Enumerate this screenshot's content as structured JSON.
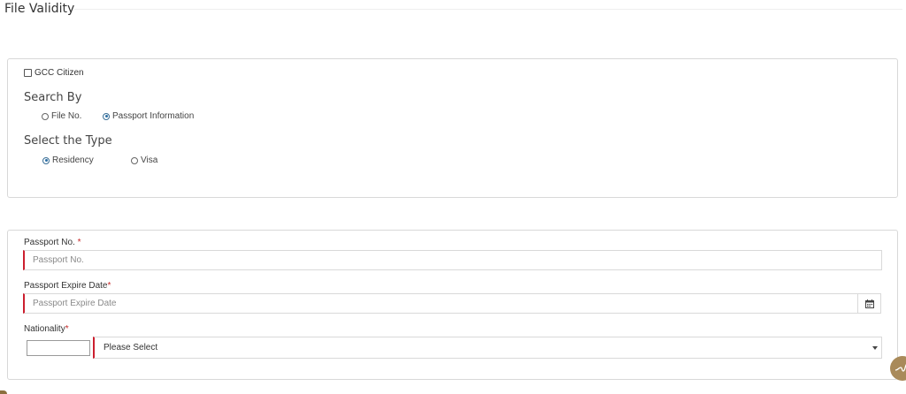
{
  "page": {
    "title": "File Validity"
  },
  "search_panel": {
    "gcc_citizen": {
      "label": "GCC Citizen",
      "checked": false
    },
    "search_by": {
      "label": "Search By",
      "options": [
        {
          "label": "File No.",
          "selected": false
        },
        {
          "label": "Passport Information",
          "selected": true
        }
      ]
    },
    "select_type": {
      "label": "Select the Type",
      "options": [
        {
          "label": "Residency",
          "selected": true
        },
        {
          "label": "Visa",
          "selected": false
        }
      ]
    }
  },
  "form_panel": {
    "passport_no": {
      "label": "Passport No.",
      "required_mark": "*",
      "placeholder": "Passport No."
    },
    "passport_expire": {
      "label": "Passport Expire Date",
      "required_mark": "*",
      "placeholder": "Passport Expire Date"
    },
    "nationality": {
      "label": "Nationality",
      "required_mark": "*",
      "code_value": "",
      "selected": "Please Select"
    }
  },
  "colors": {
    "required": "#cc1f2f",
    "accent": "#2b6ea3",
    "float_button": "#a98a5a"
  },
  "icons": {
    "calendar": "calendar-icon",
    "caret": "chevron-down-icon",
    "float": "assistant-icon"
  }
}
